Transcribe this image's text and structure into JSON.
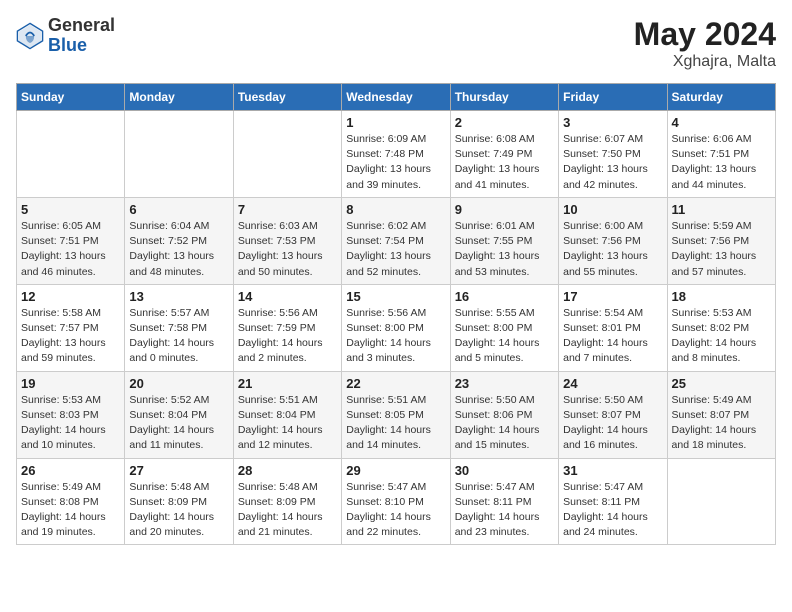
{
  "header": {
    "logo_general": "General",
    "logo_blue": "Blue",
    "month_year": "May 2024",
    "location": "Xghajra, Malta"
  },
  "days_of_week": [
    "Sunday",
    "Monday",
    "Tuesday",
    "Wednesday",
    "Thursday",
    "Friday",
    "Saturday"
  ],
  "weeks": [
    [
      {
        "day": "",
        "info": ""
      },
      {
        "day": "",
        "info": ""
      },
      {
        "day": "",
        "info": ""
      },
      {
        "day": "1",
        "info": "Sunrise: 6:09 AM\nSunset: 7:48 PM\nDaylight: 13 hours\nand 39 minutes."
      },
      {
        "day": "2",
        "info": "Sunrise: 6:08 AM\nSunset: 7:49 PM\nDaylight: 13 hours\nand 41 minutes."
      },
      {
        "day": "3",
        "info": "Sunrise: 6:07 AM\nSunset: 7:50 PM\nDaylight: 13 hours\nand 42 minutes."
      },
      {
        "day": "4",
        "info": "Sunrise: 6:06 AM\nSunset: 7:51 PM\nDaylight: 13 hours\nand 44 minutes."
      }
    ],
    [
      {
        "day": "5",
        "info": "Sunrise: 6:05 AM\nSunset: 7:51 PM\nDaylight: 13 hours\nand 46 minutes."
      },
      {
        "day": "6",
        "info": "Sunrise: 6:04 AM\nSunset: 7:52 PM\nDaylight: 13 hours\nand 48 minutes."
      },
      {
        "day": "7",
        "info": "Sunrise: 6:03 AM\nSunset: 7:53 PM\nDaylight: 13 hours\nand 50 minutes."
      },
      {
        "day": "8",
        "info": "Sunrise: 6:02 AM\nSunset: 7:54 PM\nDaylight: 13 hours\nand 52 minutes."
      },
      {
        "day": "9",
        "info": "Sunrise: 6:01 AM\nSunset: 7:55 PM\nDaylight: 13 hours\nand 53 minutes."
      },
      {
        "day": "10",
        "info": "Sunrise: 6:00 AM\nSunset: 7:56 PM\nDaylight: 13 hours\nand 55 minutes."
      },
      {
        "day": "11",
        "info": "Sunrise: 5:59 AM\nSunset: 7:56 PM\nDaylight: 13 hours\nand 57 minutes."
      }
    ],
    [
      {
        "day": "12",
        "info": "Sunrise: 5:58 AM\nSunset: 7:57 PM\nDaylight: 13 hours\nand 59 minutes."
      },
      {
        "day": "13",
        "info": "Sunrise: 5:57 AM\nSunset: 7:58 PM\nDaylight: 14 hours\nand 0 minutes."
      },
      {
        "day": "14",
        "info": "Sunrise: 5:56 AM\nSunset: 7:59 PM\nDaylight: 14 hours\nand 2 minutes."
      },
      {
        "day": "15",
        "info": "Sunrise: 5:56 AM\nSunset: 8:00 PM\nDaylight: 14 hours\nand 3 minutes."
      },
      {
        "day": "16",
        "info": "Sunrise: 5:55 AM\nSunset: 8:00 PM\nDaylight: 14 hours\nand 5 minutes."
      },
      {
        "day": "17",
        "info": "Sunrise: 5:54 AM\nSunset: 8:01 PM\nDaylight: 14 hours\nand 7 minutes."
      },
      {
        "day": "18",
        "info": "Sunrise: 5:53 AM\nSunset: 8:02 PM\nDaylight: 14 hours\nand 8 minutes."
      }
    ],
    [
      {
        "day": "19",
        "info": "Sunrise: 5:53 AM\nSunset: 8:03 PM\nDaylight: 14 hours\nand 10 minutes."
      },
      {
        "day": "20",
        "info": "Sunrise: 5:52 AM\nSunset: 8:04 PM\nDaylight: 14 hours\nand 11 minutes."
      },
      {
        "day": "21",
        "info": "Sunrise: 5:51 AM\nSunset: 8:04 PM\nDaylight: 14 hours\nand 12 minutes."
      },
      {
        "day": "22",
        "info": "Sunrise: 5:51 AM\nSunset: 8:05 PM\nDaylight: 14 hours\nand 14 minutes."
      },
      {
        "day": "23",
        "info": "Sunrise: 5:50 AM\nSunset: 8:06 PM\nDaylight: 14 hours\nand 15 minutes."
      },
      {
        "day": "24",
        "info": "Sunrise: 5:50 AM\nSunset: 8:07 PM\nDaylight: 14 hours\nand 16 minutes."
      },
      {
        "day": "25",
        "info": "Sunrise: 5:49 AM\nSunset: 8:07 PM\nDaylight: 14 hours\nand 18 minutes."
      }
    ],
    [
      {
        "day": "26",
        "info": "Sunrise: 5:49 AM\nSunset: 8:08 PM\nDaylight: 14 hours\nand 19 minutes."
      },
      {
        "day": "27",
        "info": "Sunrise: 5:48 AM\nSunset: 8:09 PM\nDaylight: 14 hours\nand 20 minutes."
      },
      {
        "day": "28",
        "info": "Sunrise: 5:48 AM\nSunset: 8:09 PM\nDaylight: 14 hours\nand 21 minutes."
      },
      {
        "day": "29",
        "info": "Sunrise: 5:47 AM\nSunset: 8:10 PM\nDaylight: 14 hours\nand 22 minutes."
      },
      {
        "day": "30",
        "info": "Sunrise: 5:47 AM\nSunset: 8:11 PM\nDaylight: 14 hours\nand 23 minutes."
      },
      {
        "day": "31",
        "info": "Sunrise: 5:47 AM\nSunset: 8:11 PM\nDaylight: 14 hours\nand 24 minutes."
      },
      {
        "day": "",
        "info": ""
      }
    ]
  ]
}
